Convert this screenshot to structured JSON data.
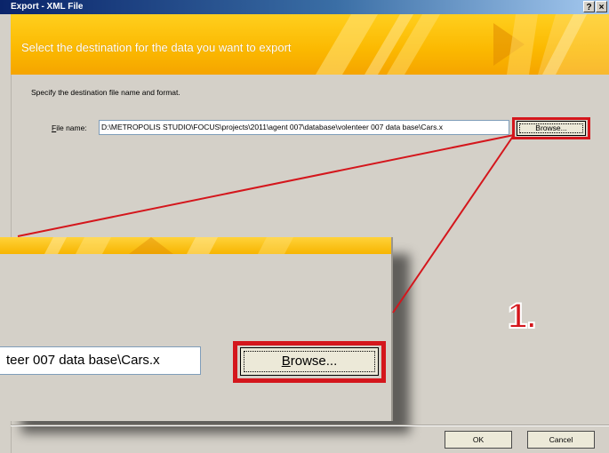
{
  "window": {
    "title": "Export - XML File",
    "help_button": "?",
    "close_button": "×"
  },
  "banner": {
    "text": "Select the destination for the data you want to export"
  },
  "instruction": "Specify the destination file name and format.",
  "file_name": {
    "label_prefix": "",
    "label_accesskey": "F",
    "label_rest": "ile name:",
    "value": "D:\\METROPOLIS STUDIO\\FOCUS\\projects\\2011\\agent 007\\database\\volenteer 007 data base\\Cars.x"
  },
  "browse_button": {
    "label": "Browse..."
  },
  "zoom_inset": {
    "field_text": "teer 007 data base\\Cars.x",
    "browse_prefix": "",
    "browse_accesskey": "B",
    "browse_rest": "rowse..."
  },
  "step_label": "1.",
  "footer": {
    "ok_label": "OK",
    "cancel_label": "Cancel"
  },
  "colors": {
    "highlight": "#d4161c",
    "banner": "#fbb800",
    "titlebar": "#0a246a"
  }
}
